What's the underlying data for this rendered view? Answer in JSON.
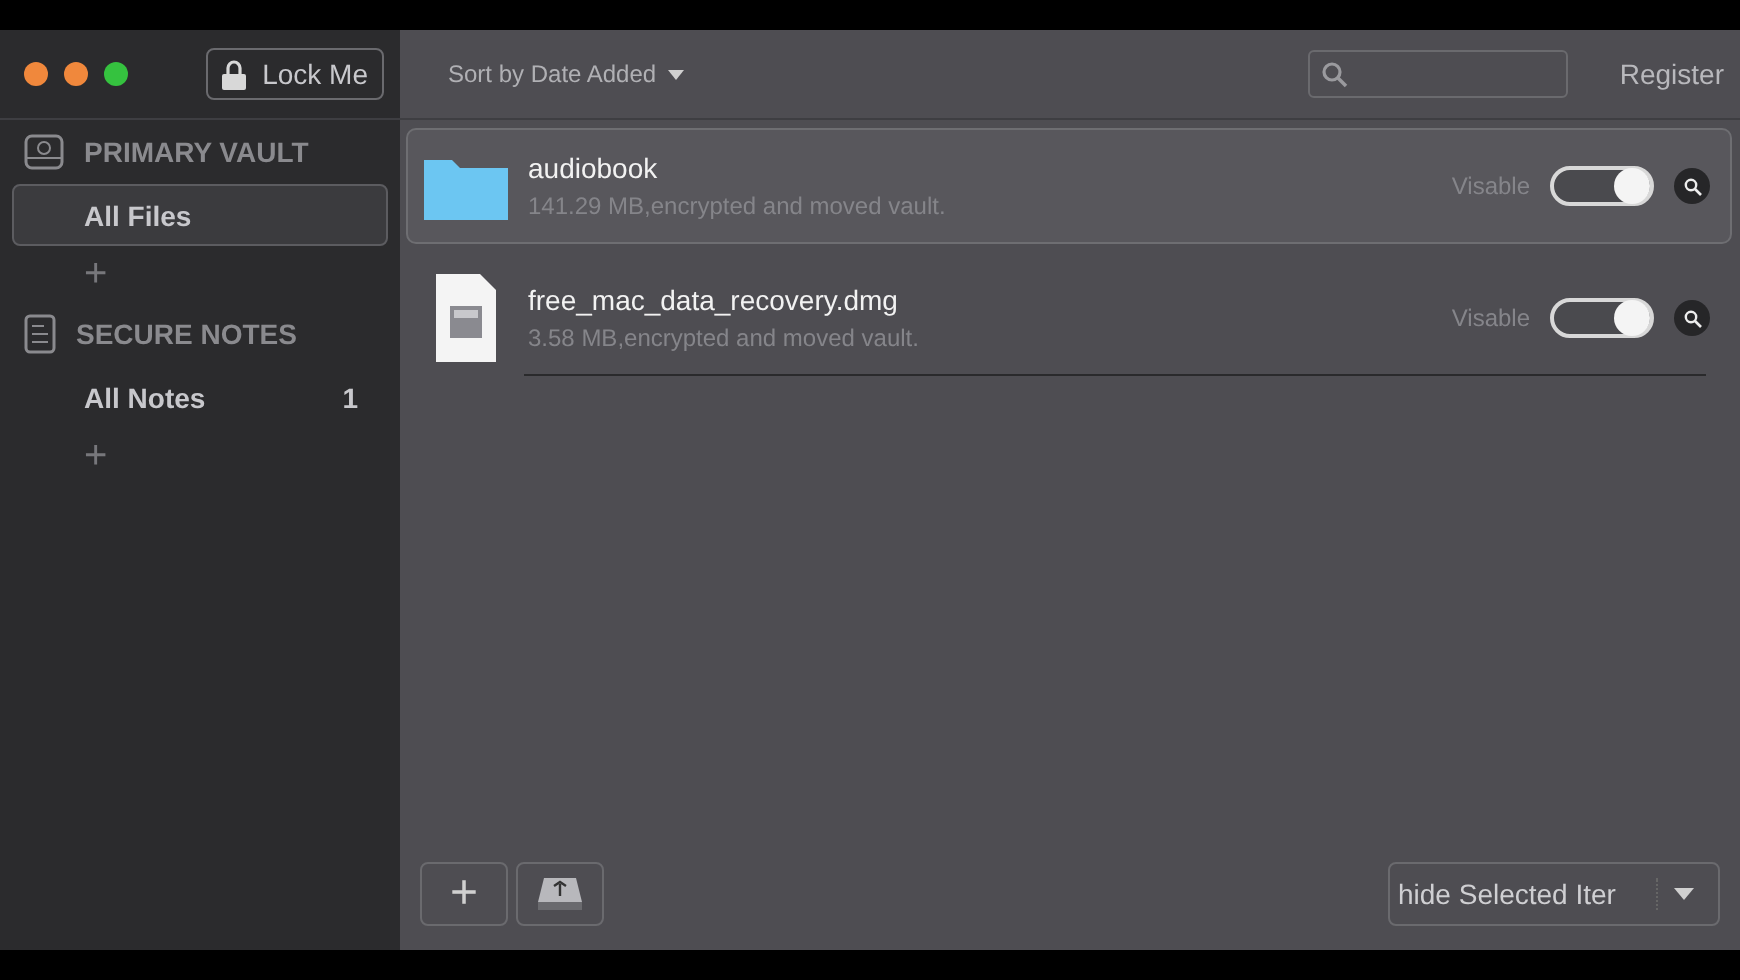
{
  "window": {
    "traffic_lights": [
      {
        "color": "#f0883c"
      },
      {
        "color": "#f0883c"
      },
      {
        "color": "#35c23f"
      }
    ],
    "lock_button": "Lock Me"
  },
  "toolbar": {
    "sort_menu": "Sort by Date Added",
    "register": "Register"
  },
  "sidebar": {
    "sections": [
      {
        "kind": "vault",
        "title": "PRIMARY VAULT",
        "items": [
          {
            "label": "All Files",
            "selected": true
          }
        ],
        "add": "+"
      },
      {
        "kind": "notes",
        "title": "SECURE NOTES",
        "items": [
          {
            "label": "All Notes",
            "count": "1",
            "selected": false
          }
        ],
        "add": "+"
      }
    ]
  },
  "files": [
    {
      "kind": "folder",
      "name": "audiobook",
      "details": "141.29 MB,encrypted and moved vault.",
      "visibility_label": "Visable",
      "on": true,
      "selected": true
    },
    {
      "kind": "disk-image",
      "name": "free_mac_data_recovery.dmg",
      "details": "3.58 MB,encrypted and moved vault.",
      "visibility_label": "Visable",
      "on": true,
      "selected": false
    }
  ],
  "footer": {
    "add": "+",
    "action_menu": "hide Selected Iter"
  }
}
